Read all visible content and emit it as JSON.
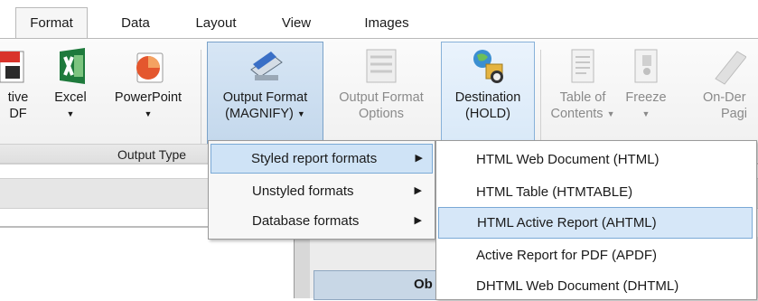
{
  "tabs": [
    "Format",
    "Data",
    "Layout",
    "View",
    "Images"
  ],
  "ribbon": {
    "active_pdf": {
      "line1": "tive",
      "line2": "DF"
    },
    "excel": {
      "label": "Excel"
    },
    "powerpoint": {
      "label": "PowerPoint"
    },
    "output_format": {
      "line1": "Output Format",
      "line2": "(MAGNIFY)"
    },
    "output_format_options": {
      "line1": "Output Format",
      "line2": "Options"
    },
    "destination": {
      "line1": "Destination",
      "line2": "(HOLD)"
    },
    "toc": {
      "line1": "Table of",
      "line2": "Contents"
    },
    "freeze": {
      "label": "Freeze"
    },
    "on_demand": {
      "line1": "On-Der",
      "line2": "Pagi"
    },
    "group_label": "Output Type"
  },
  "menu": {
    "items": [
      {
        "label": "Styled report formats"
      },
      {
        "label": "Unstyled formats"
      },
      {
        "label": "Database formats"
      }
    ]
  },
  "submenu": {
    "items": [
      {
        "label": "HTML Web Document (HTML)"
      },
      {
        "label": "HTML Table (HTMTABLE)"
      },
      {
        "label": "HTML Active Report (AHTML)"
      },
      {
        "label": "Active Report for PDF (APDF)"
      },
      {
        "label": "DHTML Web Document (DHTML)"
      }
    ]
  },
  "canvas": {
    "partial_text": "Ob"
  },
  "colors": {
    "accent": "#7aa9d6",
    "highlight": "#cfe3f6"
  }
}
